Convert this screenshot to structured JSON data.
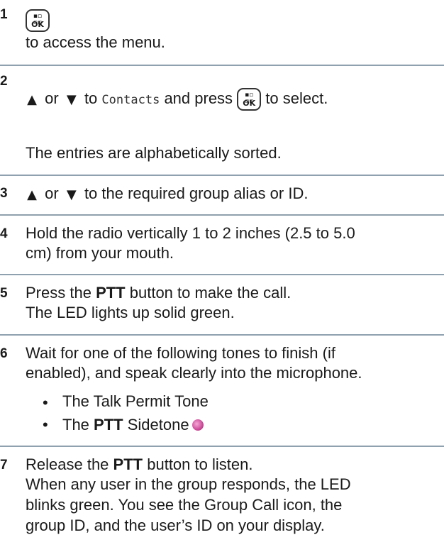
{
  "key": {
    "icon": "menu-ok-key-icon",
    "grid": "▪▫\n▫▫",
    "label": "OK"
  },
  "arrows": {
    "up": "▲",
    "down": "▼"
  },
  "steps": [
    {
      "number": "1",
      "text": "to access the menu."
    },
    {
      "number": "2",
      "line1_or": "or",
      "line1_to": "to",
      "contacts": "Contacts",
      "line1_press": "and press",
      "line1_end": "to select.",
      "line2": "The entries are alphabetically sorted."
    },
    {
      "number": "3",
      "or": "or",
      "text": "to the required group alias or ID."
    },
    {
      "number": "4",
      "line1": "Hold the radio vertically 1 to 2 inches (2.5 to 5.0",
      "line2": "cm) from your mouth."
    },
    {
      "number": "5",
      "line1_pre": "Press the",
      "line1_bold": "PTT",
      "line1_post": "button to make the call.",
      "line2": "The LED lights up solid green."
    },
    {
      "number": "6",
      "line1": "Wait for one of the following tones to finish (if",
      "line2": "enabled), and speak clearly into the microphone.",
      "bullets": [
        {
          "text": "The Talk Permit Tone"
        },
        {
          "pre": "The",
          "bold": "PTT",
          "post": "Sidetone",
          "icon": "sidetone-icon"
        }
      ]
    },
    {
      "number": "7",
      "line1_pre": "Release the",
      "line1_bold": "PTT",
      "line1_post": "button to listen.",
      "line2": "When any user in the group responds, the LED",
      "line3": "blinks green. You see the Group Call icon, the",
      "line4": "group ID, and the user’s ID on your display."
    }
  ]
}
